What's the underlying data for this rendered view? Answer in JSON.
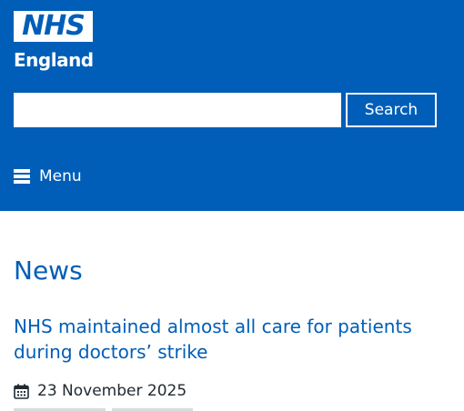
{
  "header": {
    "logo_mark": "NHS",
    "logo_subtitle": "England",
    "search": {
      "placeholder": "",
      "value": "",
      "button_label": "Search"
    },
    "menu_label": "Menu"
  },
  "main": {
    "page_title": "News",
    "article": {
      "title": "NHS maintained almost all care for patients during doctors’ strike",
      "date": "23 November 2025"
    }
  },
  "colors": {
    "brand_blue": "#005eb8",
    "text": "#212b32",
    "background": "#ffffff"
  },
  "icons": [
    "menu-icon",
    "calendar-icon"
  ]
}
